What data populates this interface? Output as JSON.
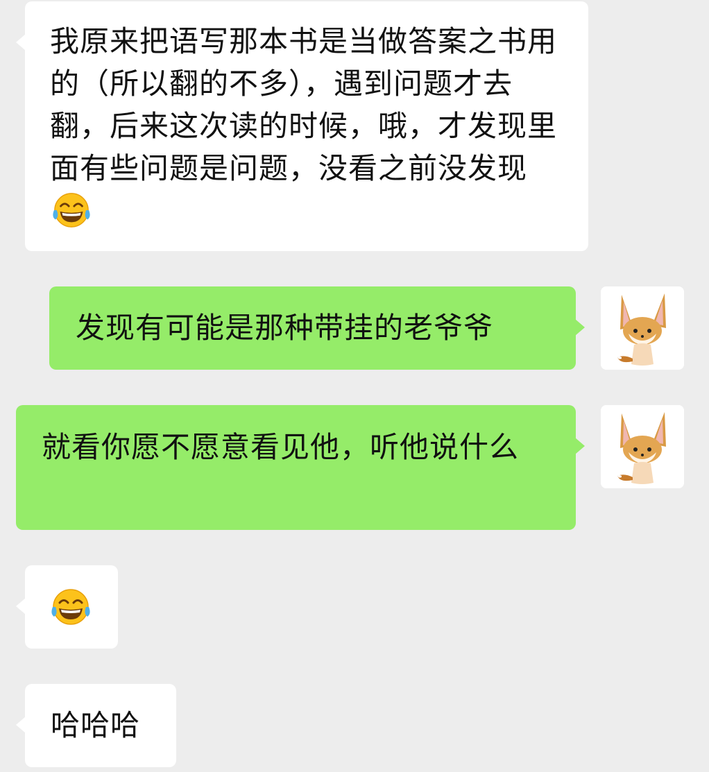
{
  "messages": [
    {
      "side": "left",
      "text": "我原来把语写那本书是当做答案之书用的（所以翻的不多），遇到问题才去翻，后来这次读的时候，哦，才发现里面有些问题是问题，没看之前没发现",
      "emoji": "face-with-tears-of-joy"
    },
    {
      "side": "right",
      "text": "发现有可能是那种带挂的老爷爷",
      "avatar": "fennec-fox-avatar"
    },
    {
      "side": "right",
      "text": "就看你愿不愿意看见他，听他说什么",
      "avatar": "fennec-fox-avatar"
    },
    {
      "side": "left",
      "text": "",
      "emoji": "face-with-tears-of-joy"
    },
    {
      "side": "left",
      "text": "哈哈哈"
    }
  ],
  "colors": {
    "background": "#ededed",
    "incoming_bubble": "#ffffff",
    "outgoing_bubble": "#95ec69",
    "text": "#111111"
  }
}
